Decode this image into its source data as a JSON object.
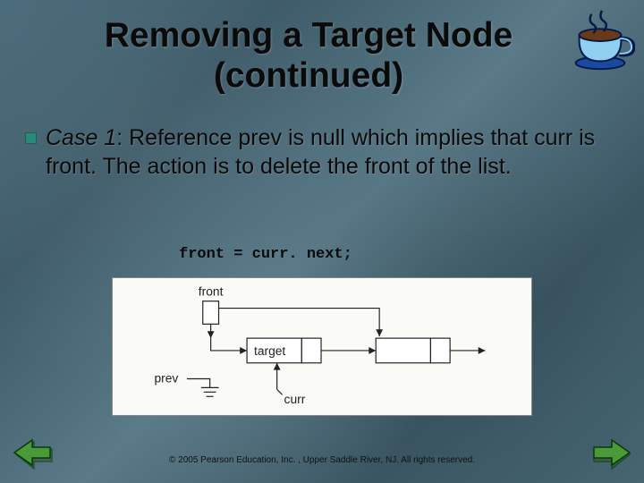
{
  "title": "Removing a Target Node (continued)",
  "case_label": "Case 1",
  "body_text": ": Reference prev is null which implies that curr is front. The action is to delete the front of the list.",
  "code": "front = curr. next;",
  "diagram": {
    "front_label": "front",
    "target_label": "target",
    "prev_label": "prev",
    "curr_label": "curr"
  },
  "footer": "© 2005 Pearson Education, Inc. , Upper Saddle River, NJ.  All rights reserved.",
  "icons": {
    "cup": "coffee-cup-icon",
    "prev": "prev-arrow-icon",
    "next": "next-arrow-icon"
  }
}
